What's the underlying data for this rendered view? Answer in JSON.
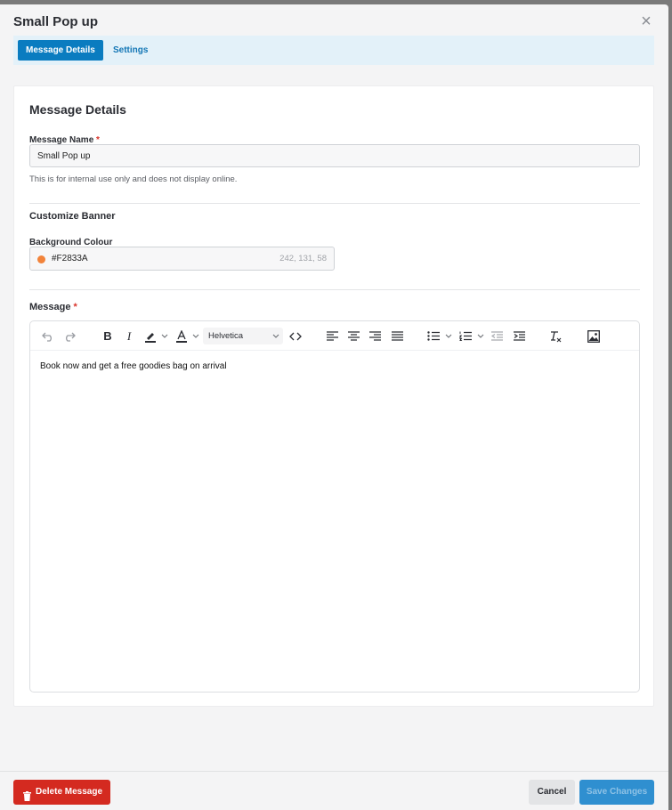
{
  "modal": {
    "title": "Small Pop up",
    "close_glyph": "×"
  },
  "tabs": [
    {
      "label": "Message Details",
      "active": true
    },
    {
      "label": "Settings",
      "active": false
    }
  ],
  "details": {
    "section_title": "Message Details",
    "name_label": "Message Name",
    "required_mark": "*",
    "name_value": "Small Pop up",
    "name_help": "This is for internal use only and does not display online."
  },
  "banner": {
    "title": "Customize Banner",
    "bg_label": "Background Colour",
    "hex": "#F2833A",
    "rgb": "242, 131, 58",
    "swatch_color": "#F2833A"
  },
  "message": {
    "label": "Message",
    "required_mark": "*",
    "font_family_value": "Helvetica",
    "content": "Book now and get a free goodies bag on arrival"
  },
  "toolbar": {
    "icons": [
      "undo-icon",
      "redo-icon",
      "bold-icon",
      "italic-icon",
      "highlight-color-icon",
      "text-color-icon",
      "source-code-icon",
      "align-left-icon",
      "align-center-icon",
      "align-right-icon",
      "justify-icon",
      "bullet-list-icon",
      "numbered-list-icon",
      "outdent-icon",
      "indent-icon",
      "clear-format-icon",
      "image-icon"
    ],
    "bold_glyph": "B",
    "italic_glyph": "I"
  },
  "footer": {
    "delete_label": "Delete Message",
    "cancel_label": "Cancel",
    "save_label": "Save Changes"
  },
  "colors": {
    "primary": "#0A7CC0",
    "danger": "#D42A20",
    "save_disabled_bg": "#2F8FD0"
  }
}
